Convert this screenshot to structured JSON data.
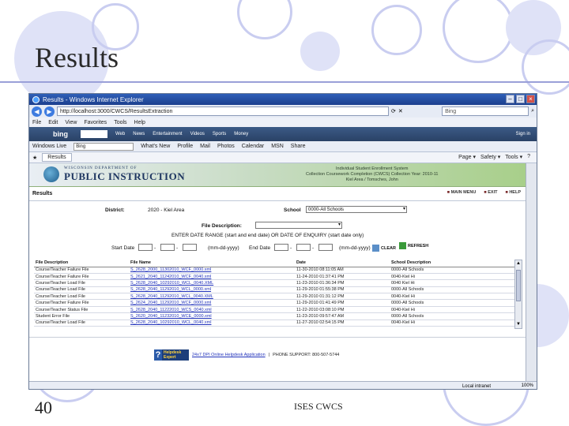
{
  "slide": {
    "title": "Results",
    "number": "40",
    "footer": "ISES CWCS"
  },
  "browser": {
    "window_title": "Results - Windows Internet Explorer",
    "address": "http://localhost:3000/CWCS/ResultsExtraction",
    "search_placeholder": "Bing",
    "menu": [
      "File",
      "Edit",
      "View",
      "Favorites",
      "Tools",
      "Help"
    ],
    "bing_label": "bing",
    "bing_items": [
      "Web",
      "News",
      "Entertainment",
      "Videos",
      "Sports",
      "Money"
    ],
    "bing_signin": "Sign in",
    "windows_live_label": "Windows Live",
    "windows_live_value": "Bing",
    "windows_live_items": [
      "What's New",
      "Profile",
      "Mail",
      "Photos",
      "Calendar",
      "MSN",
      "Share"
    ],
    "tab_label": "Results",
    "fav_right": [
      "Page ▾",
      "Safety ▾",
      "Tools ▾",
      "?"
    ],
    "status_zone": "Local intranet",
    "zoom": "100%"
  },
  "page": {
    "logo_small": "WISCONSIN DEPARTMENT OF",
    "logo_big": "PUBLIC INSTRUCTION",
    "banner_lines": [
      "Individual Student Enrollment System",
      "Collection Coursework Completion (CWCS) Collection Year: 2010-11",
      "Kiel Area / Tomsches, John"
    ],
    "heading": "Results",
    "top_links": [
      "MAIN MENU",
      "EXIT",
      "HELP"
    ],
    "district_label": "District:",
    "district_value": "2020 - Kiel Area",
    "school_label": "School",
    "school_value": "0000-All Schools",
    "file_desc_label": "File Description:",
    "date_range_label": "ENTER DATE RANGE (start and end date) OR DATE OF ENQUIRY (start date only)",
    "start_date_label": "Start Date",
    "end_date_label": "End Date",
    "date_format": "(mm-dd-yyyy)",
    "clear_label": "CLEAR",
    "refresh_label": "REFRESH",
    "table": {
      "headers": [
        "File Description",
        "File Name",
        "Date",
        "School Description"
      ],
      "rows": [
        [
          "Course/Teacher Failure File",
          "S_2628_2000_11302010_WCF_0000.xml",
          "11-30-2010 08:11:05 AM",
          "0000-All Schools"
        ],
        [
          "Course/Teacher Failure File",
          "S_2621_2040_11242010_WCF_0040.xml",
          "11-24-2010 01:37:41 PM",
          "0040-Kiel Hi"
        ],
        [
          "Course/Teacher Load File",
          "S_2628_2040_10292010_WCL_0040.XML",
          "11-23-2010 01:36:34 PM",
          "0040 Kiel Hi"
        ],
        [
          "Course/Teacher Load File",
          "S_2628_2040_11292010_WCL_0000.xml",
          "11-29-2010 01:55:38 PM",
          "0000-All Schools"
        ],
        [
          "Course/Teacher Load File",
          "S_2628_2040_11292010_WCL_0040.XML",
          "11-29-2010 01:31:12 PM",
          "0040-Kiel Hi"
        ],
        [
          "Course/Teacher Failure File",
          "S_2624_2040_11292010_WCF_0000.xml",
          "11-29-2010 01:41:49 PM",
          "0000-All Schools"
        ],
        [
          "Course/Teacher Status File",
          "S_2628_2040_11222010_WCS_0040.xml",
          "11-22-2010 03:08:10 PM",
          "0040-Kiel Hi"
        ],
        [
          "Student Error File",
          "S_2620_2040_11232010_WCE_0000.xml",
          "11-23-2010 09:57:47 AM",
          "0000-All Schools"
        ],
        [
          "Course/Teacher Load File",
          "S_2628_2040_10292010_WCL_0040.xml",
          "11-27-2010 02:54:15 PM",
          "0040-Kiel Hi"
        ]
      ]
    },
    "helpdesk_logo_line1": "Helpdesk",
    "helpdesk_logo_line2": "Expert",
    "helpdesk_link": "24x7 DPI Online Helpdesk Application",
    "phone": "PHONE SUPPORT: 800-507-5744"
  }
}
